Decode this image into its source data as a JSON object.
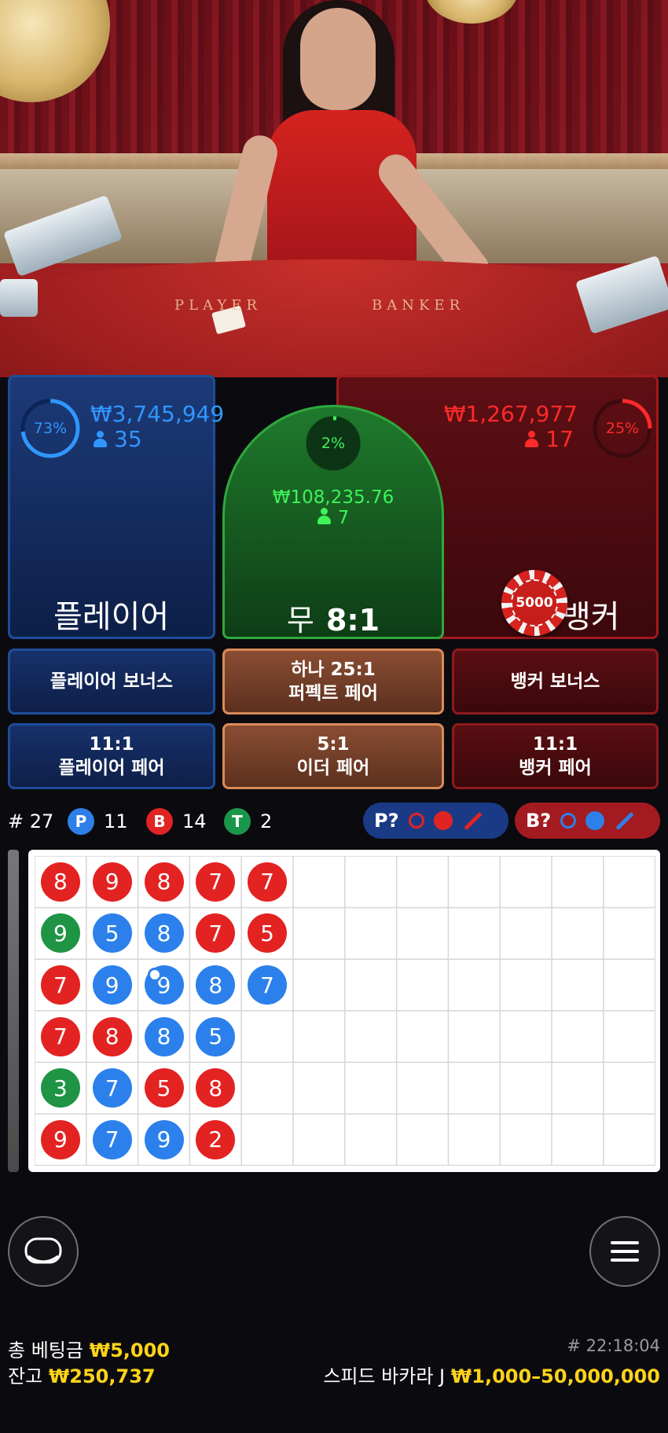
{
  "table_text": {
    "player": "PLAYER",
    "banker": "BANKER"
  },
  "player": {
    "percent": "73%",
    "amount": "₩3,745,949",
    "count": "35",
    "label": "플레이어",
    "percent_value": 73
  },
  "tie": {
    "percent": "2%",
    "amount": "₩108,235.76",
    "count": "7",
    "label_prefix": "무",
    "label_odds": "8:1",
    "percent_value": 2
  },
  "banker": {
    "percent": "25%",
    "amount": "₩1,267,977",
    "count": "17",
    "label": "뱅커",
    "percent_value": 25
  },
  "chip": {
    "value": "5000"
  },
  "side_bets": {
    "player_bonus": "플레이어 보너스",
    "perfect_pair_top": "하나 25:1",
    "perfect_pair_bottom": "퍼펙트 페어",
    "banker_bonus": "뱅커 보너스",
    "player_pair_top": "11:1",
    "player_pair_bottom": "플레이어 페어",
    "either_pair_top": "5:1",
    "either_pair_bottom": "이더 페어",
    "banker_pair_top": "11:1",
    "banker_pair_bottom": "뱅커 페어"
  },
  "stats": {
    "round": "# 27",
    "player_letter": "P",
    "player_count": "11",
    "banker_letter": "B",
    "banker_count": "14",
    "tie_letter": "T",
    "tie_count": "2",
    "player_predict": "P?",
    "banker_predict": "B?"
  },
  "road": {
    "columns": [
      [
        [
          "8",
          "red"
        ],
        [
          "9",
          "green"
        ],
        [
          "7",
          "red"
        ],
        [
          "7",
          "red"
        ],
        [
          "3",
          "green"
        ],
        [
          "9",
          "red"
        ]
      ],
      [
        [
          "9",
          "red"
        ],
        [
          "5",
          "blue"
        ],
        [
          "9",
          "blue"
        ],
        [
          "8",
          "red"
        ],
        [
          "7",
          "blue"
        ],
        [
          "7",
          "blue"
        ]
      ],
      [
        [
          "8",
          "red"
        ],
        [
          "8",
          "blue"
        ],
        [
          "9",
          "blue"
        ],
        [
          "8",
          "blue"
        ],
        [
          "5",
          "red"
        ],
        [
          "9",
          "blue"
        ]
      ],
      [
        [
          "7",
          "red"
        ],
        [
          "7",
          "red"
        ],
        [
          "8",
          "blue"
        ],
        [
          "5",
          "blue"
        ],
        [
          "8",
          "red"
        ],
        [
          "2",
          "red"
        ]
      ],
      [
        [
          "7",
          "red"
        ],
        [
          "5",
          "red"
        ],
        [
          "7",
          "blue"
        ]
      ]
    ]
  },
  "footer": {
    "total_bet_label": "총 베팅금",
    "total_bet_value": "₩5,000",
    "balance_label": "잔고",
    "balance_value": "₩250,737",
    "game_id": "# 22:18:04",
    "table_name": "스피드 바카라 J",
    "limits": "₩1,000–50,000,000"
  },
  "colors": {
    "player": "#2f97ff",
    "banker": "#ff2a2a",
    "tie": "#3ef25a",
    "accent": "#ffd31a"
  },
  "icons": {
    "left_button": "chat-icon",
    "right_button": "menu-icon"
  }
}
